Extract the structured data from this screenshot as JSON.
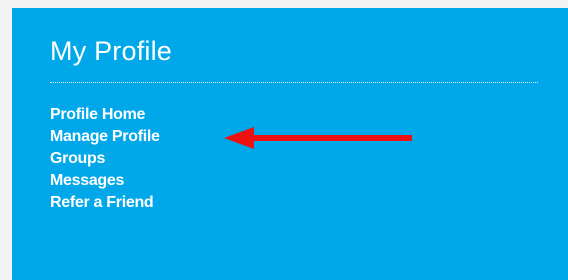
{
  "panel": {
    "title": "My Profile",
    "nav_items": [
      {
        "label": "Profile Home"
      },
      {
        "label": "Manage Profile"
      },
      {
        "label": "Groups"
      },
      {
        "label": "Messages"
      },
      {
        "label": "Refer a Friend"
      }
    ]
  },
  "colors": {
    "panel_background": "#00a8e9",
    "page_background": "#f3f3f3",
    "arrow": "#ee1111",
    "text": "#ffffff"
  },
  "annotation": {
    "icon": "left-arrow-icon",
    "points_to": "Manage Profile"
  }
}
